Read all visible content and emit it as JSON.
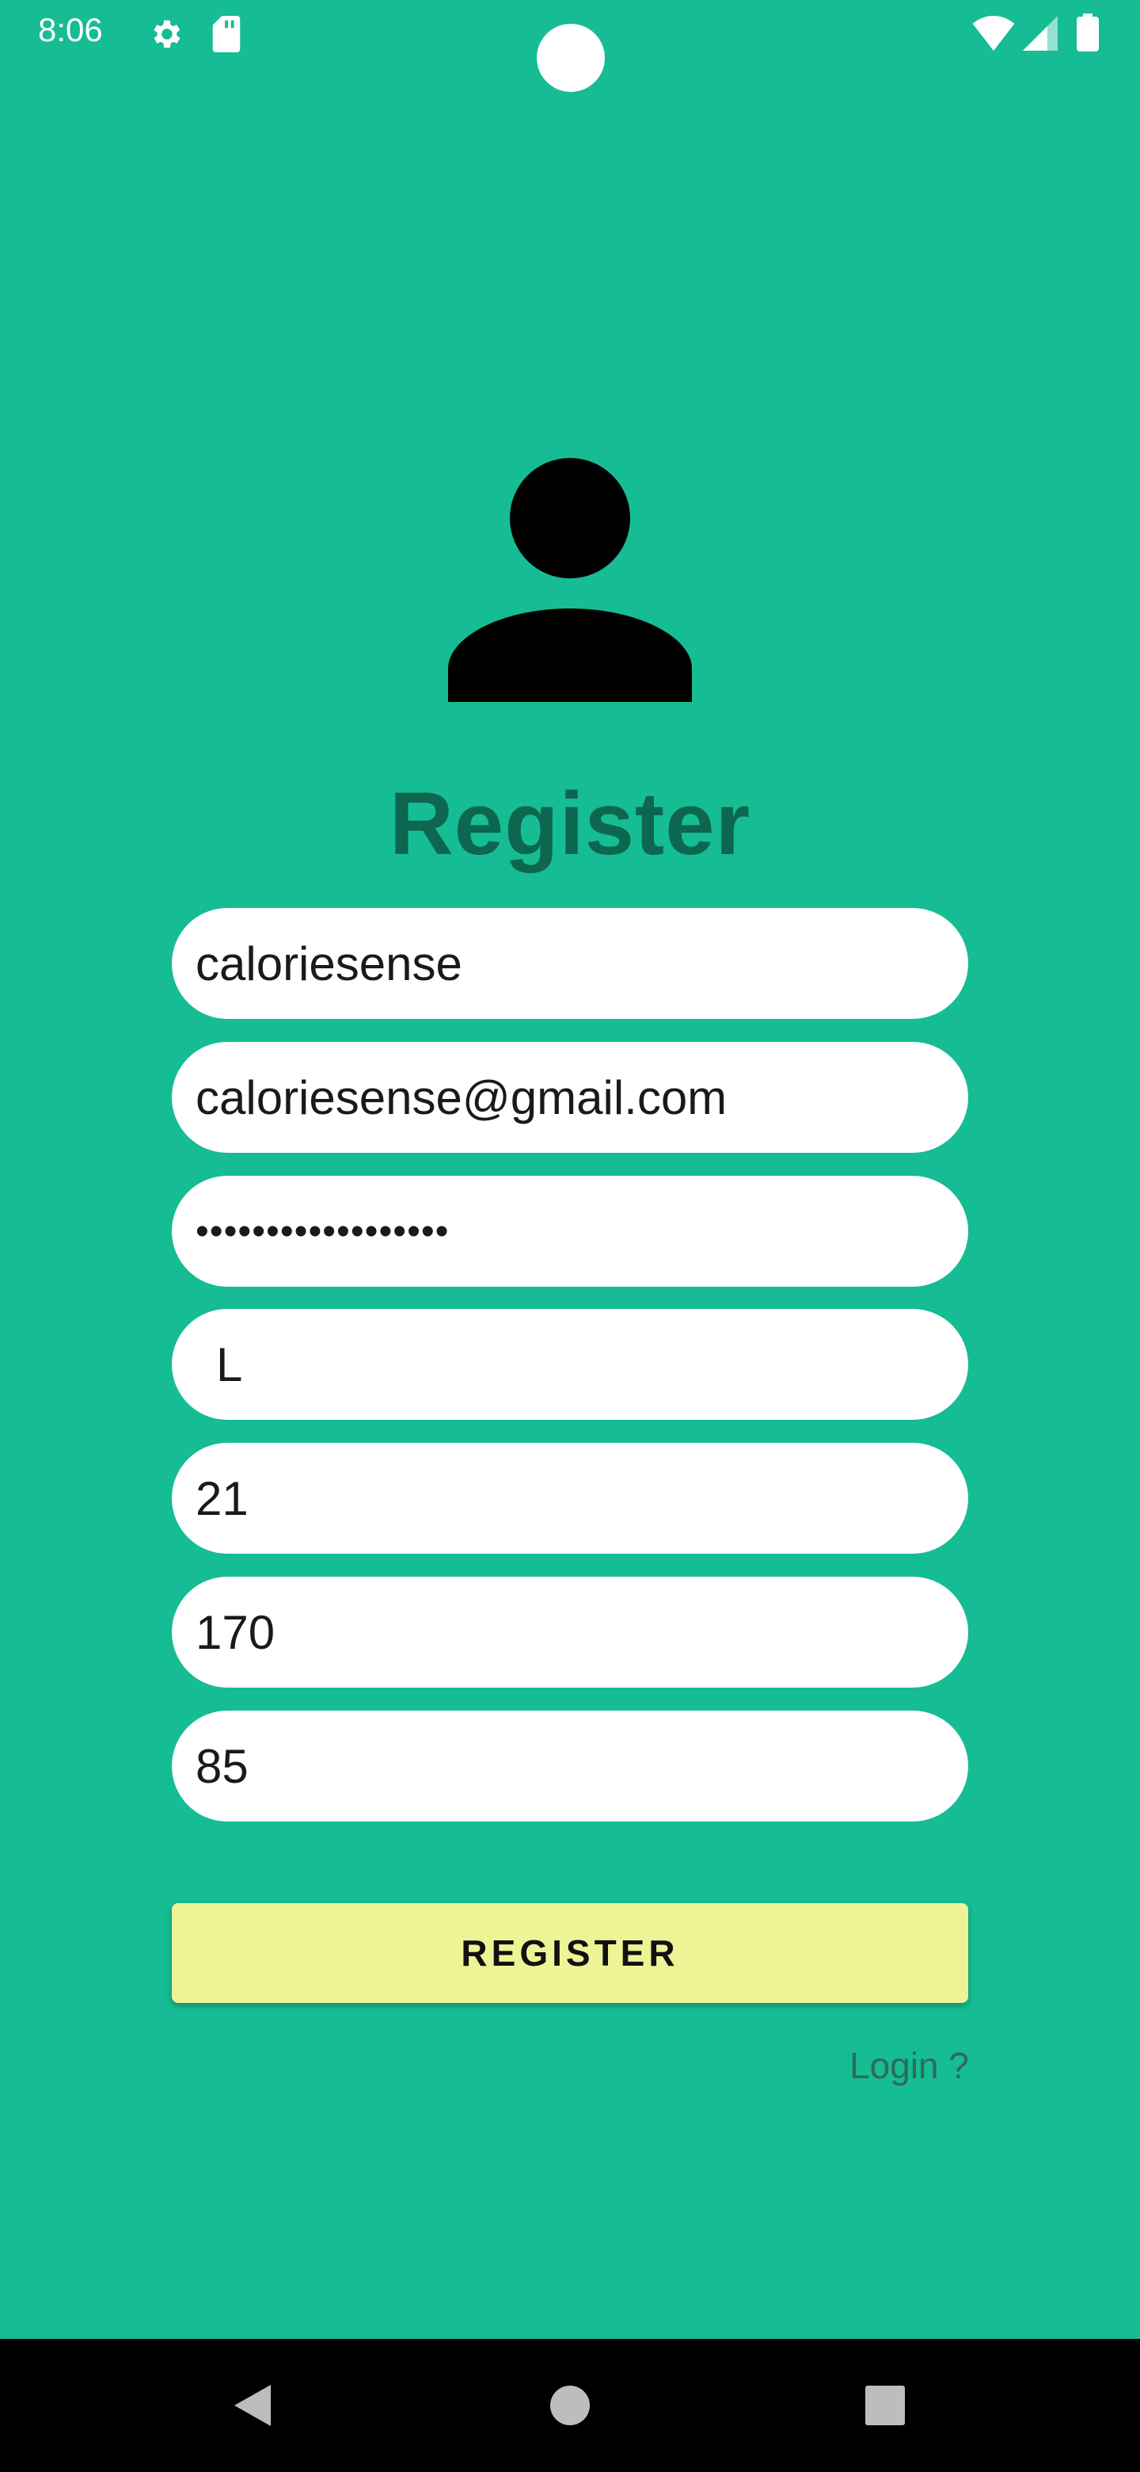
{
  "status_bar": {
    "time": "8:06",
    "icons": [
      "gear-icon",
      "sd-card-icon",
      "wifi-icon",
      "signal-icon",
      "battery-icon"
    ]
  },
  "icons": {
    "avatar": "person-icon"
  },
  "form": {
    "title": "Register",
    "fields": [
      {
        "name": "username",
        "value": "caloriesense"
      },
      {
        "name": "email",
        "value": "caloriesense@gmail.com"
      },
      {
        "name": "password",
        "value": "••••••••••••••••••"
      },
      {
        "name": "gender",
        "value": "L"
      },
      {
        "name": "age",
        "value": "21"
      },
      {
        "name": "height",
        "value": "170"
      },
      {
        "name": "weight",
        "value": "85"
      }
    ],
    "register_button": "REGISTER",
    "login_link": "Login ?"
  },
  "nav_bar": {
    "buttons": [
      "back-icon",
      "home-icon",
      "recents-icon"
    ]
  },
  "colors": {
    "background": "#16bc94",
    "title": "#0c6650",
    "button": "#eef495",
    "field": "#ffffff"
  }
}
